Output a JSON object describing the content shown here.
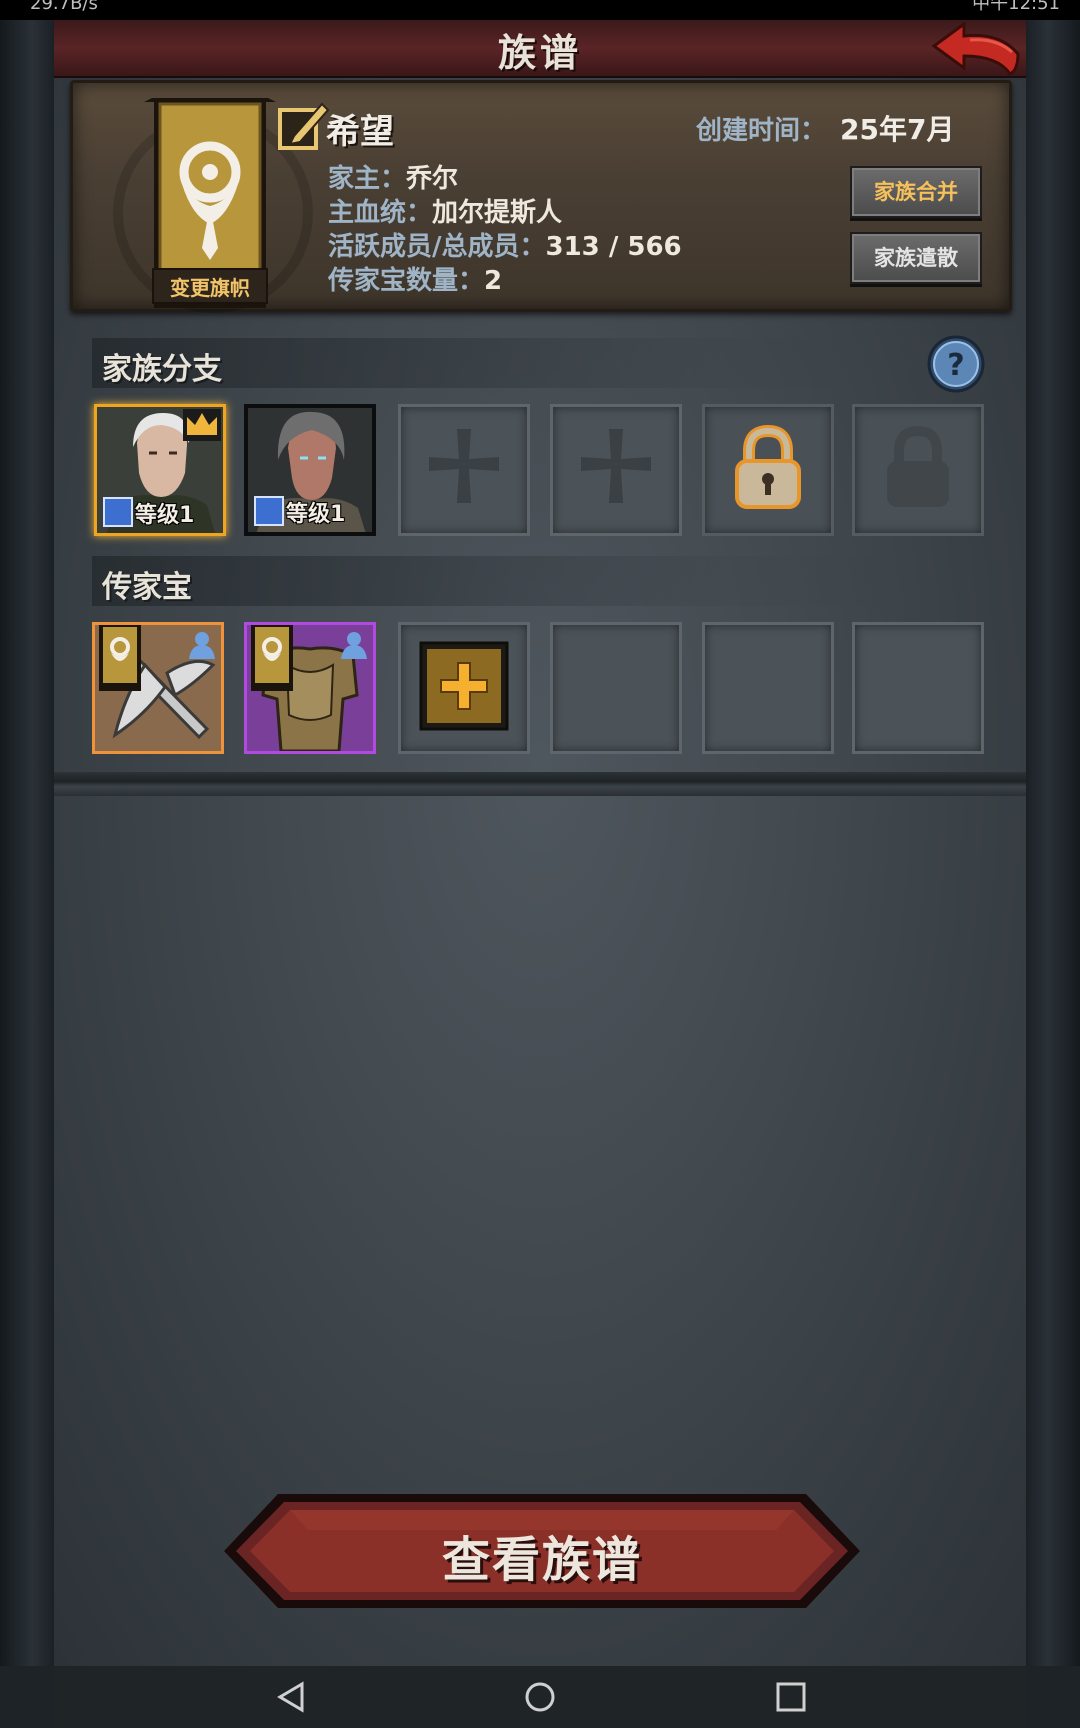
{
  "status_bar": {
    "left_text": "29.7B/s",
    "right_text": "中午12:51"
  },
  "header": {
    "title": "族谱",
    "back_icon": "back-arrow-icon"
  },
  "family": {
    "name": "希望",
    "banner_button": "变更旗帜",
    "created_label": "创建时间：",
    "created_value": "25年7月",
    "head_label": "家主：",
    "head_value": "乔尔",
    "bloodline_label": "主血统：",
    "bloodline_value": "加尔提斯人",
    "members_label": "活跃成员/总成员：",
    "members_value": "313 / 566",
    "heirloom_count_label": "传家宝数量：",
    "heirloom_count_value": "2",
    "merge_button": "家族合并",
    "disband_button": "家族遣散"
  },
  "branches": {
    "title": "家族分支",
    "help_icon": "help-icon",
    "slots": [
      {
        "type": "character",
        "level_label": "等级1",
        "leader": true
      },
      {
        "type": "character",
        "level_label": "等级1",
        "leader": false
      },
      {
        "type": "empty-cross"
      },
      {
        "type": "empty-cross"
      },
      {
        "type": "locked-next"
      },
      {
        "type": "locked"
      }
    ]
  },
  "heirlooms": {
    "title": "传家宝",
    "slots": [
      {
        "type": "weapon",
        "rarity": "orange"
      },
      {
        "type": "armor",
        "rarity": "purple"
      },
      {
        "type": "add"
      },
      {
        "type": "empty"
      },
      {
        "type": "empty"
      },
      {
        "type": "empty"
      }
    ]
  },
  "bottom_button": "查看族谱",
  "colors": {
    "header_red": "#5a2426",
    "gold_accent": "#f2c46a",
    "label_blue": "#9fb4c6",
    "rarity_orange": "#f0923a",
    "rarity_purple": "#b04ae0"
  }
}
